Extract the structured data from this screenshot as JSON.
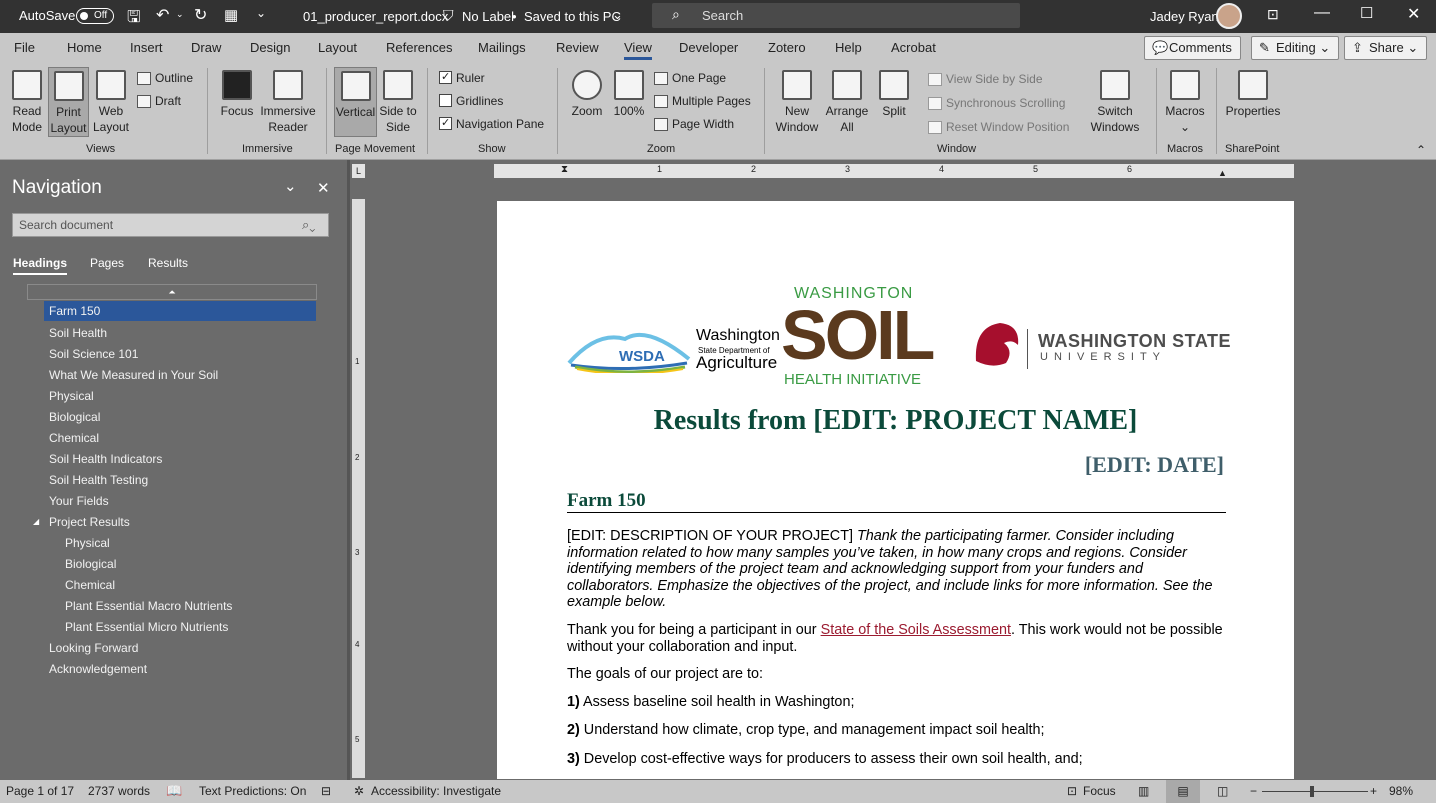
{
  "titlebar": {
    "autosave": "AutoSave",
    "toggle": "Off",
    "filename": "01_producer_report.docx",
    "label_status": "No Label",
    "saved": "Saved to this PC",
    "search": "Search",
    "user": "Jadey Ryan"
  },
  "tabs": [
    "File",
    "Home",
    "Insert",
    "Draw",
    "Design",
    "Layout",
    "References",
    "Mailings",
    "Review",
    "View",
    "Developer",
    "Zotero",
    "Help",
    "Acrobat"
  ],
  "active_tab": "View",
  "top_buttons": {
    "comments": "Comments",
    "editing": "Editing",
    "share": "Share"
  },
  "ribbon": {
    "views": {
      "label": "Views",
      "read_mode": "Read Mode",
      "print_layout": "Print Layout",
      "web_layout": "Web Layout",
      "outline": "Outline",
      "draft": "Draft"
    },
    "immersive": {
      "label": "Immersive",
      "focus": "Focus",
      "reader": "Immersive Reader"
    },
    "page_movement": {
      "label": "Page Movement",
      "vertical": "Vertical",
      "side": "Side to Side"
    },
    "show": {
      "label": "Show",
      "ruler": "Ruler",
      "gridlines": "Gridlines",
      "navigation_pane": "Navigation Pane",
      "ruler_checked": true,
      "gridlines_checked": false,
      "nav_checked": true
    },
    "zoom": {
      "label": "Zoom",
      "zoom": "Zoom",
      "hundred": "100%",
      "one_page": "One Page",
      "multiple_pages": "Multiple Pages",
      "page_width": "Page Width"
    },
    "window": {
      "label": "Window",
      "new_window": "New Window",
      "arrange_all": "Arrange All",
      "split": "Split",
      "side_by_side": "View Side by Side",
      "sync_scroll": "Synchronous Scrolling",
      "reset_pos": "Reset Window Position",
      "switch": "Switch Windows"
    },
    "macros": {
      "label": "Macros",
      "macros": "Macros"
    },
    "sharepoint": {
      "label": "SharePoint",
      "properties": "Properties"
    }
  },
  "nav": {
    "title": "Navigation",
    "search_placeholder": "Search document",
    "tabs": [
      "Headings",
      "Pages",
      "Results"
    ],
    "items": [
      {
        "label": "Farm 150",
        "level": 1,
        "selected": true
      },
      {
        "label": "Soil Health",
        "level": 1
      },
      {
        "label": "Soil Science 101",
        "level": 1
      },
      {
        "label": "What We Measured in Your Soil",
        "level": 1
      },
      {
        "label": "Physical",
        "level": 1
      },
      {
        "label": "Biological",
        "level": 1
      },
      {
        "label": "Chemical",
        "level": 1
      },
      {
        "label": "Soil Health Indicators",
        "level": 1
      },
      {
        "label": "Soil Health Testing",
        "level": 1
      },
      {
        "label": "Your Fields",
        "level": 1
      },
      {
        "label": "Project Results",
        "level": 1,
        "expanded": true
      },
      {
        "label": "Physical",
        "level": 2
      },
      {
        "label": "Biological",
        "level": 2
      },
      {
        "label": "Chemical",
        "level": 2
      },
      {
        "label": "Plant Essential Macro Nutrients",
        "level": 2
      },
      {
        "label": "Plant Essential Micro Nutrients",
        "level": 2
      },
      {
        "label": "Looking Forward",
        "level": 1
      },
      {
        "label": "Acknowledgement",
        "level": 1
      }
    ]
  },
  "ruler_numbers": [
    "1",
    "2",
    "3",
    "4",
    "5",
    "6"
  ],
  "vruler_numbers": [
    "1",
    "2",
    "3",
    "4",
    "5"
  ],
  "document": {
    "logos": {
      "wsda": "WSDA",
      "wsda_name_1": "Washington",
      "wsda_name_2": "State Department of",
      "wsda_name_3": "Agriculture",
      "soil_top": "WASHINGTON",
      "soil_mid": "SOIL",
      "soil_bottom": "HEALTH INITIATIVE",
      "wsu_1": "WASHINGTON STATE",
      "wsu_2": "UNIVERSITY"
    },
    "title": "Results from [EDIT: PROJECT NAME]",
    "date": "[EDIT: DATE]",
    "farm": "Farm 150",
    "p1_plain": "[EDIT: DESCRIPTION OF YOUR PROJECT] ",
    "p1_italic": "Thank the participating farmer. Consider including information related to how many samples you’ve taken, in how many crops and regions. Consider identifying members of the project team and acknowledging support from your funders and collaborators. Emphasize the objectives of the project, and include links for more information. See the example below.",
    "p2_a": "Thank you for being a participant in our ",
    "p2_link": "State of the Soils Assessment",
    "p2_b": ". This work would not be possible without your collaboration and input.",
    "p3": "The goals of our project are to:",
    "goals": [
      {
        "n": "1)",
        "t": " Assess baseline soil health in Washington;"
      },
      {
        "n": "2)",
        "t": " Understand how climate, crop type, and management impact soil health;"
      },
      {
        "n": "3)",
        "t": " Develop cost-effective ways for producers to assess their own soil health, and;"
      }
    ]
  },
  "status": {
    "page": "Page 1 of 17",
    "words": "2737 words",
    "predictions": "Text Predictions: On",
    "accessibility": "Accessibility: Investigate",
    "focus": "Focus",
    "zoom": "98%"
  }
}
